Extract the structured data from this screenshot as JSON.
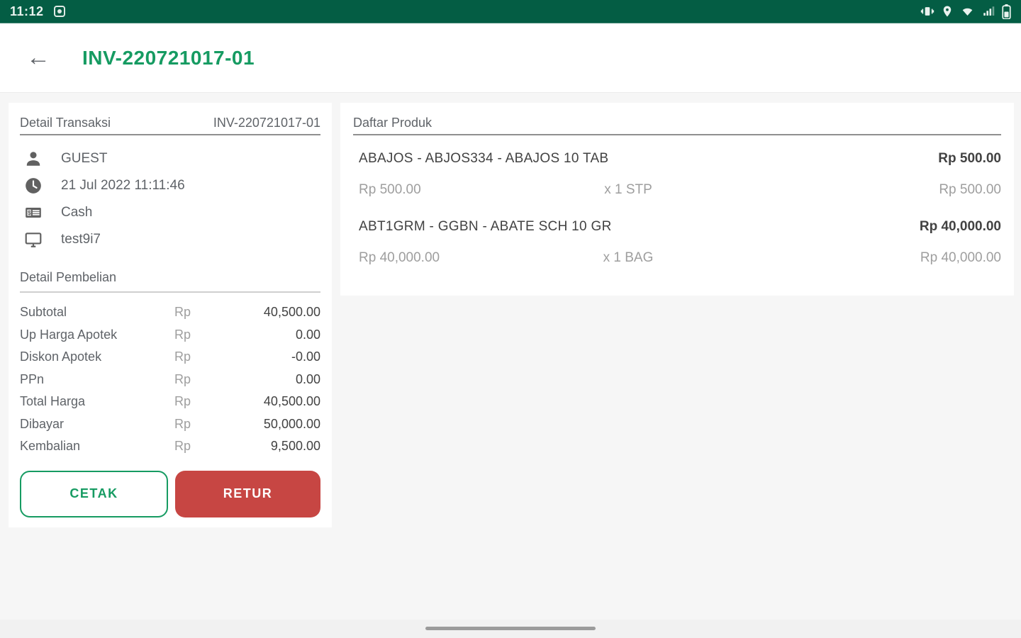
{
  "colors": {
    "statusbar_bg": "#045d44",
    "title_green": "#169b62",
    "retur_red": "#c74643",
    "text_gray": "#5f6368",
    "text_light": "#9e9e9e"
  },
  "status_bar": {
    "time": "11:12",
    "icons": [
      "app-notification",
      "vibrate",
      "location",
      "wifi",
      "signal",
      "battery"
    ]
  },
  "header": {
    "title": "INV-220721017-01",
    "back_icon": "arrow-left"
  },
  "transaction": {
    "panel_title": "Detail Transaksi",
    "invoice_no": "INV-220721017-01",
    "customer": "GUEST",
    "datetime": "21 Jul 2022 11:11:46",
    "payment_method": "Cash",
    "device": "test9i7"
  },
  "purchase": {
    "panel_title": "Detail Pembelian",
    "rows": [
      {
        "label": "Subtotal",
        "currency": "Rp",
        "value": "40,500.00"
      },
      {
        "label": "Up Harga Apotek",
        "currency": "Rp",
        "value": "0.00"
      },
      {
        "label": "Diskon Apotek",
        "currency": "Rp",
        "value": "-0.00"
      },
      {
        "label": "PPn",
        "currency": "Rp",
        "value": "0.00"
      },
      {
        "label": "Total Harga",
        "currency": "Rp",
        "value": "40,500.00"
      },
      {
        "label": "Dibayar",
        "currency": "Rp",
        "value": "50,000.00"
      },
      {
        "label": "Kembalian",
        "currency": "Rp",
        "value": "9,500.00"
      }
    ],
    "cetak_label": "CETAK",
    "retur_label": "RETUR"
  },
  "products": {
    "panel_title": "Daftar Produk",
    "items": [
      {
        "name": "ABAJOS - ABJOS334 - ABAJOS 10 TAB",
        "total": "Rp 500.00",
        "unit_price": "Rp 500.00",
        "qty": "x 1 STP",
        "subtotal": "Rp 500.00"
      },
      {
        "name": "ABT1GRM - GGBN - ABATE SCH 10 GR",
        "total": "Rp 40,000.00",
        "unit_price": "Rp 40,000.00",
        "qty": "x 1 BAG",
        "subtotal": "Rp 40,000.00"
      }
    ]
  }
}
